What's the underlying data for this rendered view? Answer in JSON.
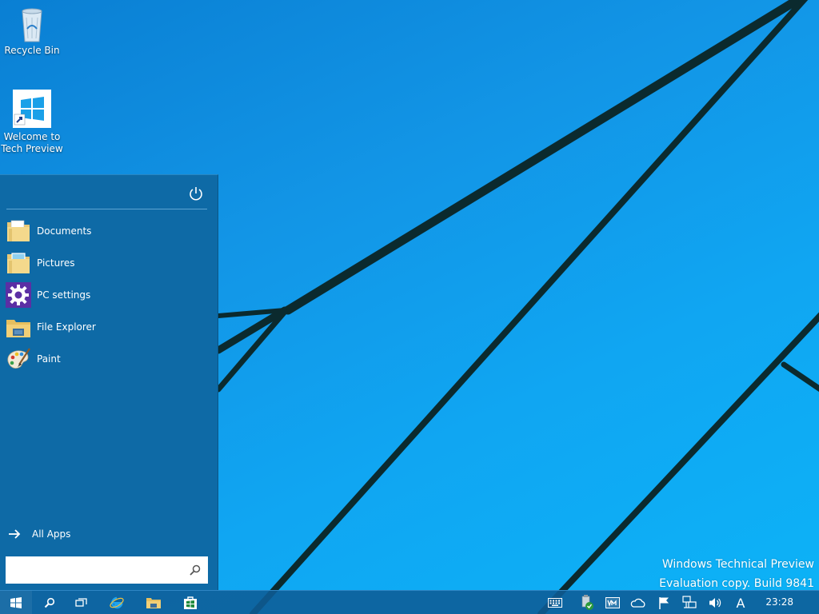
{
  "desktop": {
    "icons": [
      {
        "label": "Recycle Bin",
        "icon": "recycle-bin-icon"
      },
      {
        "label": "Welcome to Tech Preview",
        "icon": "windows-logo-shortcut-icon"
      }
    ]
  },
  "start_menu": {
    "power_icon": "power-icon",
    "items": [
      {
        "label": "Documents",
        "icon": "documents-folder-icon"
      },
      {
        "label": "Pictures",
        "icon": "pictures-folder-icon"
      },
      {
        "label": "PC settings",
        "icon": "gear-icon"
      },
      {
        "label": "File Explorer",
        "icon": "file-explorer-icon"
      },
      {
        "label": "Paint",
        "icon": "paint-palette-icon"
      }
    ],
    "all_apps": {
      "label": "All Apps",
      "icon": "arrow-right-icon"
    },
    "search": {
      "value": "",
      "placeholder": "",
      "icon": "search-icon"
    }
  },
  "watermark": {
    "line1": "Windows Technical Preview",
    "line2": "Evaluation copy. Build 9841"
  },
  "taskbar": {
    "start_icon": "windows-start-icon",
    "pinned": [
      {
        "icon": "search-icon"
      },
      {
        "icon": "task-view-icon"
      },
      {
        "icon": "internet-explorer-icon"
      },
      {
        "icon": "file-explorer-icon"
      },
      {
        "icon": "store-icon"
      }
    ],
    "tray": [
      {
        "icon": "keyboard-icon"
      },
      {
        "icon": "security-shield-icon"
      },
      {
        "icon": "vmware-tools-icon"
      },
      {
        "icon": "onedrive-icon"
      },
      {
        "icon": "action-center-flag-icon"
      },
      {
        "icon": "network-icon"
      },
      {
        "icon": "volume-icon"
      },
      {
        "icon": "input-language-icon"
      }
    ],
    "input_language": "A",
    "clock": "23:28"
  },
  "colors": {
    "desktop_accent": "#1295e6",
    "start_menu_bg": "#0e6aa6",
    "taskbar_bg": "#0e5c96",
    "wallpaper_lines": "#0b2a2e"
  }
}
